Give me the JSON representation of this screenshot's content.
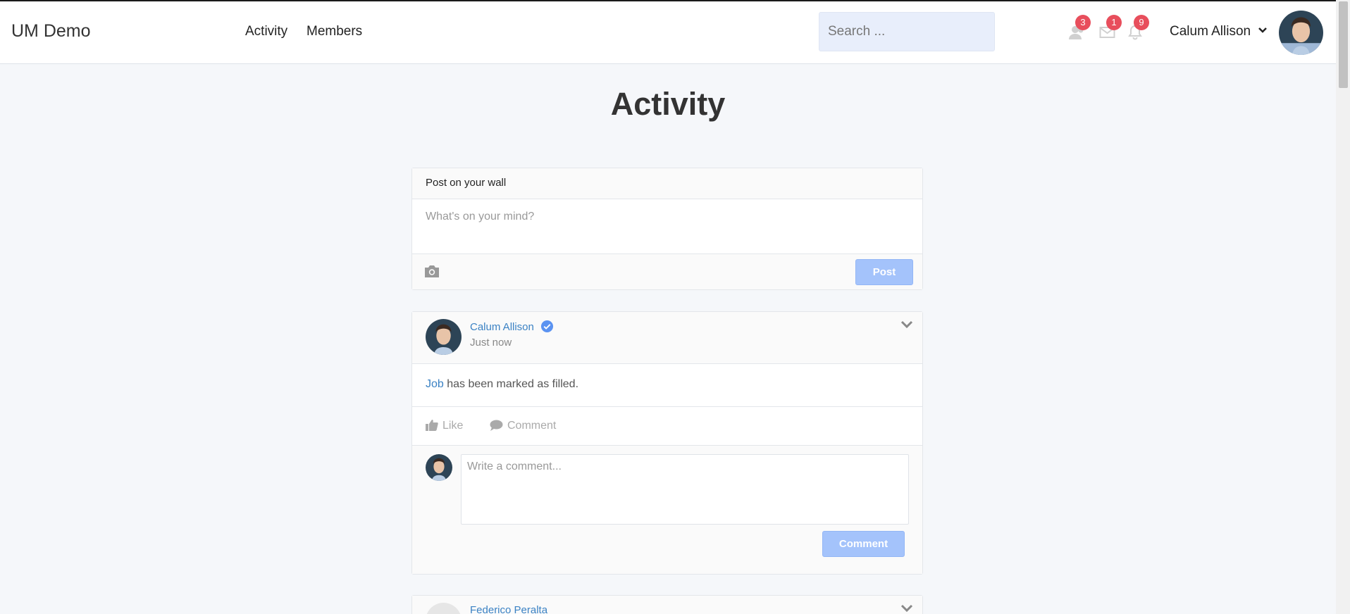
{
  "navbar": {
    "brand": "UM Demo",
    "links": [
      "Activity",
      "Members"
    ],
    "search_placeholder": "Search ...",
    "badges": {
      "friends": "3",
      "messages": "1",
      "notifications": "9"
    },
    "user_name": "Calum Allison"
  },
  "page": {
    "title": "Activity"
  },
  "post_box": {
    "header": "Post on your wall",
    "placeholder": "What's on your mind?",
    "post_label": "Post"
  },
  "activity": {
    "author": "Calum Allison",
    "time": "Just now",
    "body_link": "Job",
    "body_text": " has been marked as filled.",
    "like_label": "Like",
    "comment_label": "Comment",
    "comment_placeholder": "Write a comment...",
    "comment_button": "Comment"
  },
  "activity2": {
    "author": "Federico Peralta"
  },
  "colors": {
    "accent": "#3b82c4",
    "button": "#a4c3fb",
    "badge": "#e84e5c"
  },
  "icons": [
    "friends-icon",
    "mail-icon",
    "bell-icon",
    "camera-icon",
    "verified-icon",
    "chevron-down-icon",
    "thumbs-up-icon",
    "comment-icon"
  ]
}
